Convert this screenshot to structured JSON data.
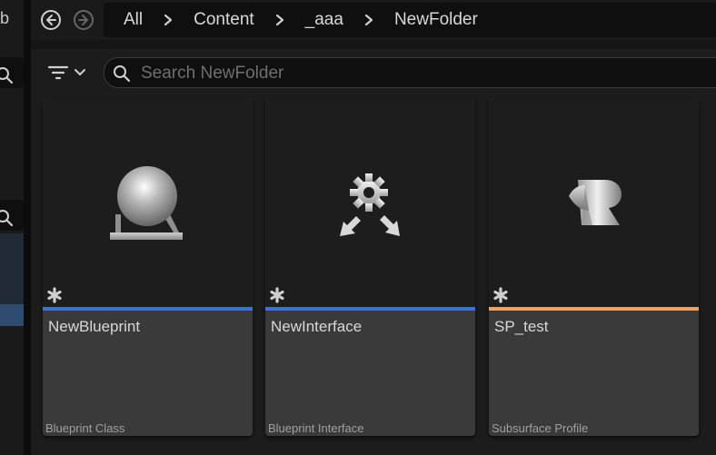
{
  "left_panel": {
    "cut_text": "b"
  },
  "nav": {
    "breadcrumb": [
      "All",
      "Content",
      "_aaa",
      "NewFolder"
    ]
  },
  "search": {
    "placeholder": "Search NewFolder",
    "value": ""
  },
  "assets": [
    {
      "name": "NewBlueprint",
      "type": "Blueprint Class",
      "color": "#3f6fd8",
      "icon": "blueprint-sphere-icon"
    },
    {
      "name": "NewInterface",
      "type": "Blueprint Interface",
      "color": "#3f6fd8",
      "icon": "interface-gear-arrows-icon"
    },
    {
      "name": "SP_test",
      "type": "Subsurface Profile",
      "color": "#f0a060",
      "icon": "subsurface-profile-icon"
    }
  ]
}
